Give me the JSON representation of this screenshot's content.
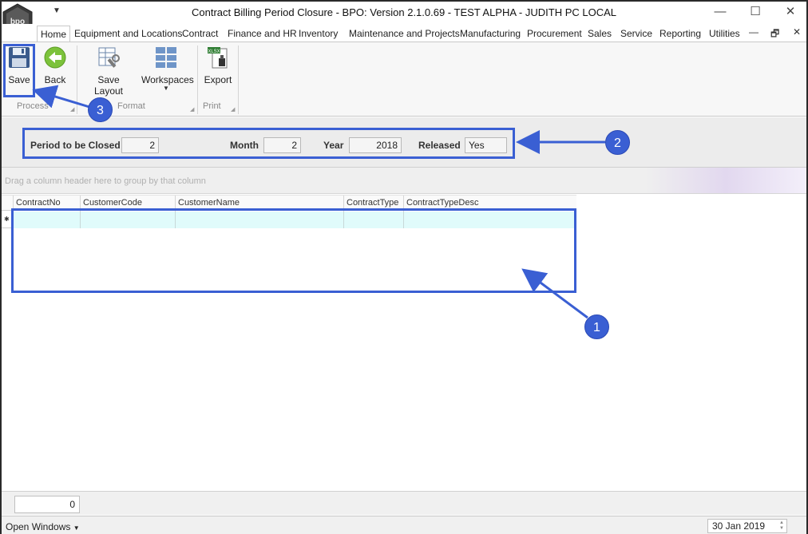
{
  "title": "Contract Billing Period Closure - BPO: Version 2.1.0.69 - TEST ALPHA - JUDITH PC LOCAL",
  "menu": {
    "tabs": [
      "Home",
      "Equipment and Locations",
      "Contract",
      "Finance and HR",
      "Inventory",
      "Maintenance and Projects",
      "Manufacturing",
      "Procurement",
      "Sales",
      "Service",
      "Reporting",
      "Utilities"
    ]
  },
  "ribbon": {
    "save": "Save",
    "back": "Back",
    "save_layout": "Save Layout",
    "workspaces": "Workspaces",
    "export": "Export",
    "group_process": "Process",
    "group_format": "Format",
    "group_print": "Print"
  },
  "params": {
    "period_label": "Period to be Closed",
    "period_value": "2",
    "month_label": "Month",
    "month_value": "2",
    "year_label": "Year",
    "year_value": "2018",
    "released_label": "Released",
    "released_value": "Yes"
  },
  "grid": {
    "group_hint": "Drag a column header here to group by that column",
    "columns": [
      "ContractNo",
      "CustomerCode",
      "CustomerName",
      "ContractType",
      "ContractTypeDesc"
    ]
  },
  "footer": {
    "count": "0"
  },
  "status": {
    "open_windows": "Open Windows",
    "date": "30 Jan 2019"
  },
  "annotations": {
    "badge_1": "1",
    "badge_2": "2",
    "badge_3": "3",
    "color": "#3a5fd3"
  }
}
